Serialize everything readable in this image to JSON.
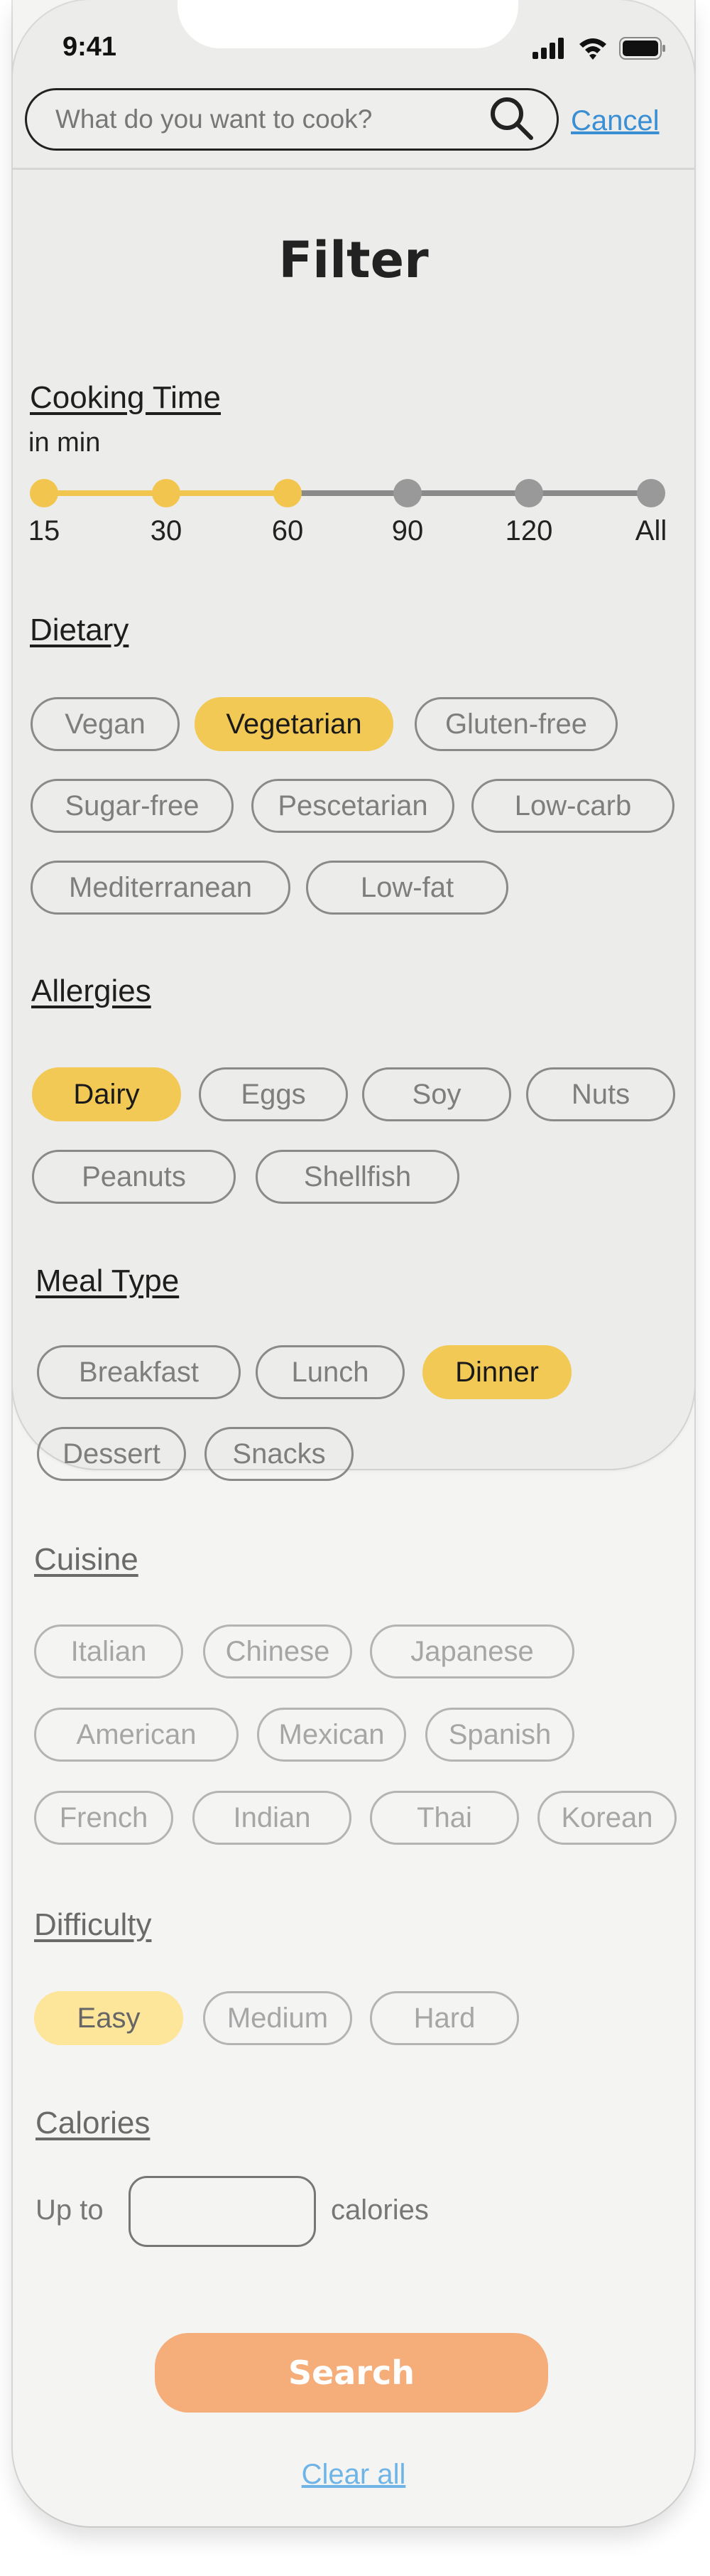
{
  "status_bar": {
    "time": "9:41",
    "icons": [
      "cellular-signal-icon",
      "wifi-icon",
      "battery-icon"
    ]
  },
  "search": {
    "placeholder": "What do you want to cook?",
    "value": "",
    "icon": "search-icon",
    "cancel_label": "Cancel"
  },
  "title": "Filter",
  "cooking_time": {
    "title": "Cooking Time",
    "unit_label": "in min",
    "options": [
      "15",
      "30",
      "60",
      "90",
      "120",
      "All"
    ],
    "selected_up_to": "60"
  },
  "dietary": {
    "title": "Dietary",
    "options": [
      {
        "label": "Vegan",
        "selected": false
      },
      {
        "label": "Vegetarian",
        "selected": true
      },
      {
        "label": "Gluten-free",
        "selected": false
      },
      {
        "label": "Sugar-free",
        "selected": false
      },
      {
        "label": "Pescetarian",
        "selected": false
      },
      {
        "label": "Low-carb",
        "selected": false
      },
      {
        "label": "Mediterranean",
        "selected": false
      },
      {
        "label": "Low-fat",
        "selected": false
      }
    ]
  },
  "allergies": {
    "title": "Allergies",
    "options": [
      {
        "label": "Dairy",
        "selected": true
      },
      {
        "label": "Eggs",
        "selected": false
      },
      {
        "label": "Soy",
        "selected": false
      },
      {
        "label": "Nuts",
        "selected": false
      },
      {
        "label": "Peanuts",
        "selected": false
      },
      {
        "label": "Shellfish",
        "selected": false
      }
    ]
  },
  "meal_type": {
    "title": "Meal Type",
    "options": [
      {
        "label": "Breakfast",
        "selected": false
      },
      {
        "label": "Lunch",
        "selected": false
      },
      {
        "label": "Dinner",
        "selected": true
      },
      {
        "label": "Dessert",
        "selected": false
      },
      {
        "label": "Snacks",
        "selected": false
      }
    ]
  },
  "cuisine": {
    "title": "Cuisine",
    "options": [
      {
        "label": "Italian",
        "selected": false
      },
      {
        "label": "Chinese",
        "selected": false
      },
      {
        "label": "Japanese",
        "selected": false
      },
      {
        "label": "American",
        "selected": false
      },
      {
        "label": "Mexican",
        "selected": false
      },
      {
        "label": "Spanish",
        "selected": false
      },
      {
        "label": "French",
        "selected": false
      },
      {
        "label": "Indian",
        "selected": false
      },
      {
        "label": "Thai",
        "selected": false
      },
      {
        "label": "Korean",
        "selected": false
      }
    ]
  },
  "difficulty": {
    "title": "Difficulty",
    "options": [
      {
        "label": "Easy",
        "selected": true
      },
      {
        "label": "Medium",
        "selected": false
      },
      {
        "label": "Hard",
        "selected": false
      }
    ]
  },
  "calories": {
    "title": "Calories",
    "prefix": "Up to",
    "value": "",
    "suffix": "calories"
  },
  "actions": {
    "search_label": "Search",
    "clear_label": "Clear all"
  },
  "colors": {
    "accent_yellow": "#f2c955",
    "search_button": "#f5ad7a",
    "link_blue": "#3a8fd4"
  }
}
